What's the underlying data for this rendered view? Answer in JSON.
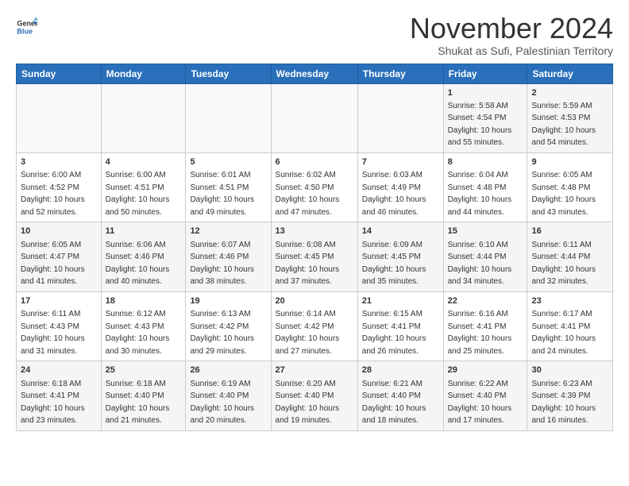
{
  "logo": {
    "line1": "General",
    "line2": "Blue"
  },
  "title": "November 2024",
  "subtitle": "Shukat as Sufi, Palestinian Territory",
  "days_of_week": [
    "Sunday",
    "Monday",
    "Tuesday",
    "Wednesday",
    "Thursday",
    "Friday",
    "Saturday"
  ],
  "weeks": [
    [
      {
        "day": "",
        "info": ""
      },
      {
        "day": "",
        "info": ""
      },
      {
        "day": "",
        "info": ""
      },
      {
        "day": "",
        "info": ""
      },
      {
        "day": "",
        "info": ""
      },
      {
        "day": "1",
        "info": "Sunrise: 5:58 AM\nSunset: 4:54 PM\nDaylight: 10 hours\nand 55 minutes."
      },
      {
        "day": "2",
        "info": "Sunrise: 5:59 AM\nSunset: 4:53 PM\nDaylight: 10 hours\nand 54 minutes."
      }
    ],
    [
      {
        "day": "3",
        "info": "Sunrise: 6:00 AM\nSunset: 4:52 PM\nDaylight: 10 hours\nand 52 minutes."
      },
      {
        "day": "4",
        "info": "Sunrise: 6:00 AM\nSunset: 4:51 PM\nDaylight: 10 hours\nand 50 minutes."
      },
      {
        "day": "5",
        "info": "Sunrise: 6:01 AM\nSunset: 4:51 PM\nDaylight: 10 hours\nand 49 minutes."
      },
      {
        "day": "6",
        "info": "Sunrise: 6:02 AM\nSunset: 4:50 PM\nDaylight: 10 hours\nand 47 minutes."
      },
      {
        "day": "7",
        "info": "Sunrise: 6:03 AM\nSunset: 4:49 PM\nDaylight: 10 hours\nand 46 minutes."
      },
      {
        "day": "8",
        "info": "Sunrise: 6:04 AM\nSunset: 4:48 PM\nDaylight: 10 hours\nand 44 minutes."
      },
      {
        "day": "9",
        "info": "Sunrise: 6:05 AM\nSunset: 4:48 PM\nDaylight: 10 hours\nand 43 minutes."
      }
    ],
    [
      {
        "day": "10",
        "info": "Sunrise: 6:05 AM\nSunset: 4:47 PM\nDaylight: 10 hours\nand 41 minutes."
      },
      {
        "day": "11",
        "info": "Sunrise: 6:06 AM\nSunset: 4:46 PM\nDaylight: 10 hours\nand 40 minutes."
      },
      {
        "day": "12",
        "info": "Sunrise: 6:07 AM\nSunset: 4:46 PM\nDaylight: 10 hours\nand 38 minutes."
      },
      {
        "day": "13",
        "info": "Sunrise: 6:08 AM\nSunset: 4:45 PM\nDaylight: 10 hours\nand 37 minutes."
      },
      {
        "day": "14",
        "info": "Sunrise: 6:09 AM\nSunset: 4:45 PM\nDaylight: 10 hours\nand 35 minutes."
      },
      {
        "day": "15",
        "info": "Sunrise: 6:10 AM\nSunset: 4:44 PM\nDaylight: 10 hours\nand 34 minutes."
      },
      {
        "day": "16",
        "info": "Sunrise: 6:11 AM\nSunset: 4:44 PM\nDaylight: 10 hours\nand 32 minutes."
      }
    ],
    [
      {
        "day": "17",
        "info": "Sunrise: 6:11 AM\nSunset: 4:43 PM\nDaylight: 10 hours\nand 31 minutes."
      },
      {
        "day": "18",
        "info": "Sunrise: 6:12 AM\nSunset: 4:43 PM\nDaylight: 10 hours\nand 30 minutes."
      },
      {
        "day": "19",
        "info": "Sunrise: 6:13 AM\nSunset: 4:42 PM\nDaylight: 10 hours\nand 29 minutes."
      },
      {
        "day": "20",
        "info": "Sunrise: 6:14 AM\nSunset: 4:42 PM\nDaylight: 10 hours\nand 27 minutes."
      },
      {
        "day": "21",
        "info": "Sunrise: 6:15 AM\nSunset: 4:41 PM\nDaylight: 10 hours\nand 26 minutes."
      },
      {
        "day": "22",
        "info": "Sunrise: 6:16 AM\nSunset: 4:41 PM\nDaylight: 10 hours\nand 25 minutes."
      },
      {
        "day": "23",
        "info": "Sunrise: 6:17 AM\nSunset: 4:41 PM\nDaylight: 10 hours\nand 24 minutes."
      }
    ],
    [
      {
        "day": "24",
        "info": "Sunrise: 6:18 AM\nSunset: 4:41 PM\nDaylight: 10 hours\nand 23 minutes."
      },
      {
        "day": "25",
        "info": "Sunrise: 6:18 AM\nSunset: 4:40 PM\nDaylight: 10 hours\nand 21 minutes."
      },
      {
        "day": "26",
        "info": "Sunrise: 6:19 AM\nSunset: 4:40 PM\nDaylight: 10 hours\nand 20 minutes."
      },
      {
        "day": "27",
        "info": "Sunrise: 6:20 AM\nSunset: 4:40 PM\nDaylight: 10 hours\nand 19 minutes."
      },
      {
        "day": "28",
        "info": "Sunrise: 6:21 AM\nSunset: 4:40 PM\nDaylight: 10 hours\nand 18 minutes."
      },
      {
        "day": "29",
        "info": "Sunrise: 6:22 AM\nSunset: 4:40 PM\nDaylight: 10 hours\nand 17 minutes."
      },
      {
        "day": "30",
        "info": "Sunrise: 6:23 AM\nSunset: 4:39 PM\nDaylight: 10 hours\nand 16 minutes."
      }
    ]
  ]
}
